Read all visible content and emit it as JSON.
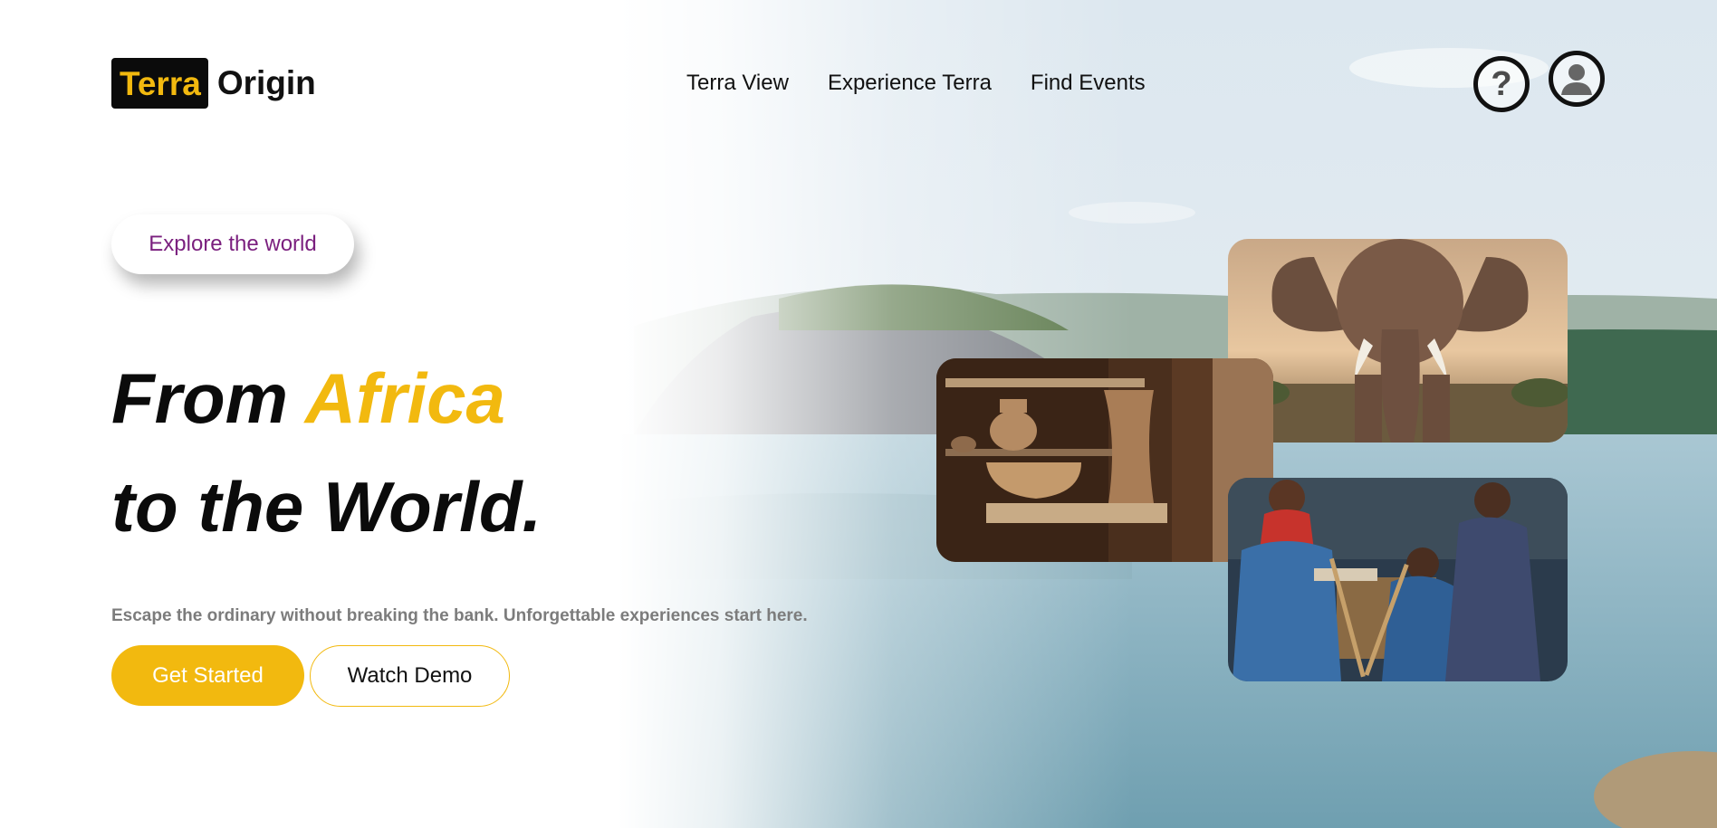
{
  "logo": {
    "box_text": "Terra",
    "text": "Origin"
  },
  "nav": {
    "items": [
      {
        "label": "Terra View"
      },
      {
        "label": "Experience Terra"
      },
      {
        "label": "Find Events"
      }
    ]
  },
  "header_icons": {
    "help": "question-mark-icon",
    "user": "user-icon",
    "help_glyph": "?"
  },
  "hero": {
    "pill_label": "Explore the world",
    "headline_part1": "From ",
    "headline_accent": "Africa",
    "headline_line2": "to the World.",
    "subtitle": "Escape the ordinary without breaking the bank. Unforgettable experiences start here.",
    "primary_button": "Get Started",
    "secondary_button": "Watch Demo"
  },
  "images": [
    {
      "name": "elephant-photo",
      "subject": "elephant"
    },
    {
      "name": "pottery-photo",
      "subject": "pottery"
    },
    {
      "name": "people-photo",
      "subject": "women in traditional dress"
    }
  ],
  "colors": {
    "accent": "#f2b90f",
    "pill_text": "#7a1f7e",
    "text_dark": "#111111",
    "subtitle": "#7c7c7c"
  }
}
